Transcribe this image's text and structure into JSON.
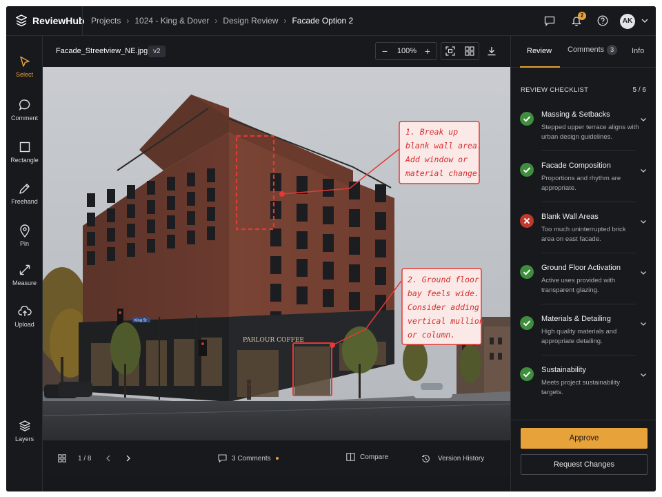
{
  "app": {
    "name": "ReviewHub"
  },
  "breadcrumb": [
    "Projects",
    "1024 - King & Dover",
    "Design Review",
    "Facade Option 2"
  ],
  "header": {
    "notification_count": "2",
    "user_initials": "AK"
  },
  "tools": [
    {
      "label": "Select",
      "icon": "cursor-icon",
      "active": true
    },
    {
      "label": "Comment",
      "icon": "comment-icon"
    },
    {
      "label": "Rectangle",
      "icon": "rectangle-icon"
    },
    {
      "label": "Freehand",
      "icon": "pencil-icon"
    },
    {
      "label": "Pin",
      "icon": "pin-icon"
    },
    {
      "label": "Measure",
      "icon": "measure-icon"
    },
    {
      "label": "Upload",
      "icon": "upload-icon"
    },
    {
      "label": "Layers",
      "icon": "layers-icon"
    }
  ],
  "file": {
    "name": "Facade_Streetview_NE.jpg",
    "version": "v2",
    "zoom": "100%"
  },
  "annotations": [
    {
      "text": "1. Break up blank wall area. Add window or material change.",
      "lines": [
        "1. Break up",
        "blank wall area.",
        "Add window or",
        "material change."
      ]
    },
    {
      "text": "2. Ground floor bay feels wide. Consider adding vertical mullion or column.",
      "lines": [
        "2. Ground floor",
        "bay feels wide.",
        "Consider adding",
        "vertical mullion",
        "or column."
      ]
    }
  ],
  "scene": {
    "storefront_sign": "PARLOUR COFFEE",
    "street_sign": "King St"
  },
  "bottom": {
    "page": "1 / 8",
    "comments": "3 Comments",
    "compare": "Compare",
    "history": "Version History"
  },
  "panel": {
    "tabs": [
      {
        "label": "Review",
        "active": true
      },
      {
        "label": "Comments",
        "count": "3"
      },
      {
        "label": "Info"
      }
    ],
    "checklist_title": "REVIEW CHECKLIST",
    "checklist_progress": "5 / 6",
    "items": [
      {
        "title": "Massing & Setbacks",
        "desc": "Stepped upper terrace aligns with urban design guidelines.",
        "status": "pass"
      },
      {
        "title": "Facade Composition",
        "desc": "Proportions and rhythm are appropriate.",
        "status": "pass"
      },
      {
        "title": "Blank Wall Areas",
        "desc": "Too much uninterrupted brick area on east facade.",
        "status": "fail"
      },
      {
        "title": "Ground Floor Activation",
        "desc": "Active uses provided with transparent glazing.",
        "status": "pass"
      },
      {
        "title": "Materials & Detailing",
        "desc": "High quality materials and appropriate detailing.",
        "status": "pass"
      },
      {
        "title": "Sustainability",
        "desc": "Meets project sustainability targets.",
        "status": "pass"
      }
    ],
    "approve_label": "Approve",
    "request_label": "Request Changes"
  },
  "colors": {
    "accent": "#e8a23a",
    "pass": "#3e8e3e",
    "fail": "#c0392b",
    "annotation": "#e53935"
  }
}
